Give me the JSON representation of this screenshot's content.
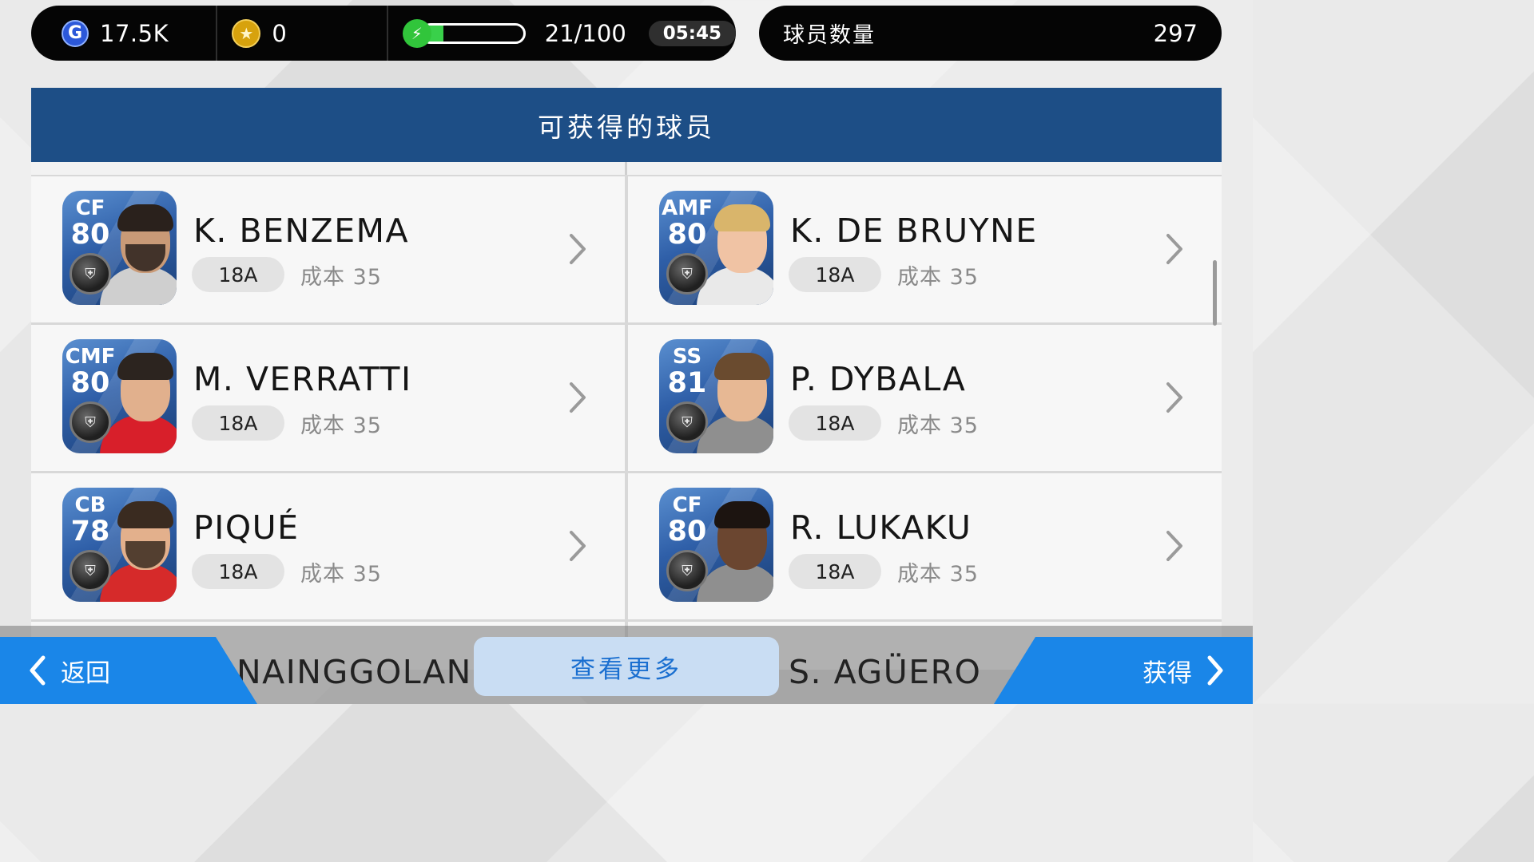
{
  "status": {
    "g_points": "17.5K",
    "coins": "0",
    "energy_text": "21/100",
    "energy_fraction": 0.21,
    "timer": "05:45"
  },
  "player_count": {
    "label": "球员数量",
    "value": "297"
  },
  "header": {
    "title": "可获得的球员"
  },
  "players": [
    {
      "position": "CF",
      "rating": "80",
      "name": "K. BENZEMA",
      "tag": "18A",
      "cost": "成本 35",
      "kit": "#cfcfcf"
    },
    {
      "position": "AMF",
      "rating": "80",
      "name": "K. DE BRUYNE",
      "tag": "18A",
      "cost": "成本 35",
      "kit": "#e9e9e9"
    },
    {
      "position": "CMF",
      "rating": "80",
      "name": "M. VERRATTI",
      "tag": "18A",
      "cost": "成本 35",
      "kit": "#d81f2a"
    },
    {
      "position": "SS",
      "rating": "81",
      "name": "P. DYBALA",
      "tag": "18A",
      "cost": "成本 35",
      "kit": "#8f8f8f"
    },
    {
      "position": "CB",
      "rating": "78",
      "name": "PIQUÉ",
      "tag": "18A",
      "cost": "成本 35",
      "kit": "#d62a2a"
    },
    {
      "position": "CF",
      "rating": "80",
      "name": "R. LUKAKU",
      "tag": "18A",
      "cost": "成本 35",
      "kit": "#8f8f8f"
    }
  ],
  "peek": {
    "left_name": "NAINGGOLAN",
    "right_name": "S. AGÜERO"
  },
  "buttons": {
    "back": "返回",
    "more": "查看更多",
    "get": "获得"
  },
  "colors": {
    "header_bg": "#1d4e86",
    "button_blue": "#1a86e8",
    "energy_green": "#39d04a"
  }
}
